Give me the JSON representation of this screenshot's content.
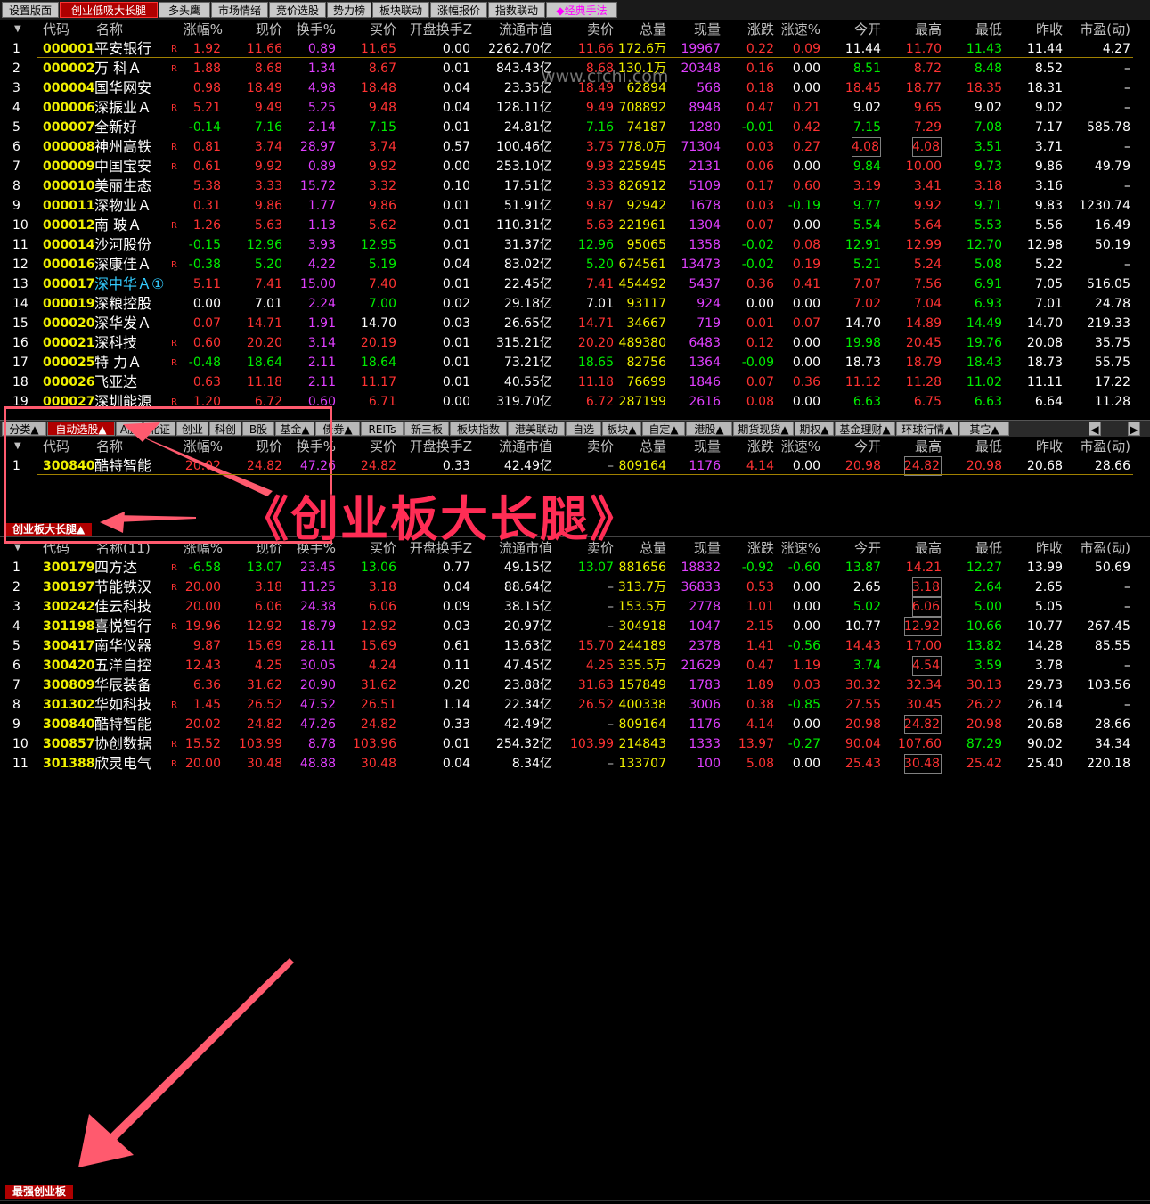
{
  "top_tabs": [
    "设置版面",
    "创业低吸大长腿",
    "多头鹰",
    "市场情绪",
    "竞价选股",
    "势力榜",
    "板块联动",
    "涨幅报价",
    "指数联动",
    "◆经典手法"
  ],
  "columns": [
    "代码",
    "名称",
    "",
    "涨幅%",
    "现价",
    "换手%",
    "买价",
    "开盘换手Z",
    "流通市值",
    "卖价",
    "总量",
    "现量",
    "涨跌",
    "涨速%",
    "今开",
    "最高",
    "最低",
    "昨收",
    "市盈(动)"
  ],
  "columns_lower": [
    "代码",
    "名称(11)",
    "",
    "涨幅%",
    "现价",
    "换手%",
    "买价",
    "开盘换手Z",
    "流通市值",
    "卖价",
    "总量",
    "现量",
    "涨跌",
    "涨速%",
    "今开",
    "最高",
    "最低",
    "昨收",
    "市盈(动)"
  ],
  "watermark": "www.cfchi.com",
  "overlay_title": "《创业板大长腿》",
  "colors": {
    "red": "#ff3333",
    "green": "#00ee00",
    "white": "#ffffff",
    "yellow": "#f0f000",
    "magenta": "#e040ff",
    "cyan": "#33ccff",
    "gray": "#c0c0c0",
    "accent": "#b00000"
  },
  "table1": [
    [
      "1",
      "000001",
      "平安银行",
      "R",
      "1.92",
      "11.66",
      "0.89",
      "11.65",
      "0.00",
      "2262.70亿",
      "11.66",
      "172.6万",
      "19967",
      "0.22",
      "0.09",
      "11.44",
      "11.70",
      "11.43",
      "11.44",
      "4.27"
    ],
    [
      "2",
      "000002",
      "万 科Ａ",
      "R",
      "1.88",
      "8.68",
      "1.34",
      "8.67",
      "0.01",
      "843.43亿",
      "8.68",
      "130.1万",
      "20348",
      "0.16",
      "0.00",
      "8.51",
      "8.72",
      "8.48",
      "8.52",
      "–"
    ],
    [
      "3",
      "000004",
      "国华网安",
      "",
      "0.98",
      "18.49",
      "4.98",
      "18.48",
      "0.04",
      "23.35亿",
      "18.49",
      "62894",
      "568",
      "0.18",
      "0.00",
      "18.45",
      "18.77",
      "18.35",
      "18.31",
      "–"
    ],
    [
      "4",
      "000006",
      "深振业Ａ",
      "R",
      "5.21",
      "9.49",
      "5.25",
      "9.48",
      "0.04",
      "128.11亿",
      "9.49",
      "708892",
      "8948",
      "0.47",
      "0.21",
      "9.02",
      "9.65",
      "9.02",
      "9.02",
      "–"
    ],
    [
      "5",
      "000007",
      "全新好",
      "",
      "-0.14",
      "7.16",
      "2.14",
      "7.15",
      "0.01",
      "24.81亿",
      "7.16",
      "74187",
      "1280",
      "-0.01",
      "0.42",
      "7.15",
      "7.29",
      "7.08",
      "7.17",
      "585.78"
    ],
    [
      "6",
      "000008",
      "神州高铁",
      "R",
      "0.81",
      "3.74",
      "28.97",
      "3.74",
      "0.57",
      "100.46亿",
      "3.75",
      "778.0万",
      "71304",
      "0.03",
      "0.27",
      "4.08",
      "4.08",
      "3.51",
      "3.71",
      "–"
    ],
    [
      "7",
      "000009",
      "中国宝安",
      "R",
      "0.61",
      "9.92",
      "0.89",
      "9.92",
      "0.00",
      "253.10亿",
      "9.93",
      "225945",
      "2131",
      "0.06",
      "0.00",
      "9.84",
      "10.00",
      "9.73",
      "9.86",
      "49.79"
    ],
    [
      "8",
      "000010",
      "美丽生态",
      "",
      "5.38",
      "3.33",
      "15.72",
      "3.32",
      "0.10",
      "17.51亿",
      "3.33",
      "826912",
      "5109",
      "0.17",
      "0.60",
      "3.19",
      "3.41",
      "3.18",
      "3.16",
      "–"
    ],
    [
      "9",
      "000011",
      "深物业Ａ",
      "",
      "0.31",
      "9.86",
      "1.77",
      "9.86",
      "0.01",
      "51.91亿",
      "9.87",
      "92942",
      "1678",
      "0.03",
      "-0.19",
      "9.77",
      "9.92",
      "9.71",
      "9.83",
      "1230.74"
    ],
    [
      "10",
      "000012",
      "南 玻Ａ",
      "R",
      "1.26",
      "5.63",
      "1.13",
      "5.62",
      "0.01",
      "110.31亿",
      "5.63",
      "221961",
      "1304",
      "0.07",
      "0.00",
      "5.54",
      "5.64",
      "5.53",
      "5.56",
      "16.49"
    ],
    [
      "11",
      "000014",
      "沙河股份",
      "",
      "-0.15",
      "12.96",
      "3.93",
      "12.95",
      "0.01",
      "31.37亿",
      "12.96",
      "95065",
      "1358",
      "-0.02",
      "0.08",
      "12.91",
      "12.99",
      "12.70",
      "12.98",
      "50.19"
    ],
    [
      "12",
      "000016",
      "深康佳Ａ",
      "R",
      "-0.38",
      "5.20",
      "4.22",
      "5.19",
      "0.04",
      "83.02亿",
      "5.20",
      "674561",
      "13473",
      "-0.02",
      "0.19",
      "5.21",
      "5.24",
      "5.08",
      "5.22",
      "–"
    ],
    [
      "13",
      "000017",
      "深中华Ａ①",
      "",
      "5.11",
      "7.41",
      "15.00",
      "7.40",
      "0.01",
      "22.45亿",
      "7.41",
      "454492",
      "5437",
      "0.36",
      "0.41",
      "7.07",
      "7.56",
      "6.91",
      "7.05",
      "516.05"
    ],
    [
      "14",
      "000019",
      "深粮控股",
      "",
      "0.00",
      "7.01",
      "2.24",
      "7.00",
      "0.02",
      "29.18亿",
      "7.01",
      "93117",
      "924",
      "0.00",
      "0.00",
      "7.02",
      "7.04",
      "6.93",
      "7.01",
      "24.78"
    ],
    [
      "15",
      "000020",
      "深华发Ａ",
      "",
      "0.07",
      "14.71",
      "1.91",
      "14.70",
      "0.03",
      "26.65亿",
      "14.71",
      "34667",
      "719",
      "0.01",
      "0.07",
      "14.70",
      "14.89",
      "14.49",
      "14.70",
      "219.33"
    ],
    [
      "16",
      "000021",
      "深科技",
      "R",
      "0.60",
      "20.20",
      "3.14",
      "20.19",
      "0.01",
      "315.21亿",
      "20.20",
      "489380",
      "6483",
      "0.12",
      "0.00",
      "19.98",
      "20.45",
      "19.76",
      "20.08",
      "35.75"
    ],
    [
      "17",
      "000025",
      "特 力Ａ",
      "R",
      "-0.48",
      "18.64",
      "2.11",
      "18.64",
      "0.01",
      "73.21亿",
      "18.65",
      "82756",
      "1364",
      "-0.09",
      "0.00",
      "18.73",
      "18.79",
      "18.43",
      "18.73",
      "55.75"
    ],
    [
      "18",
      "000026",
      "飞亚达",
      "",
      "0.63",
      "11.18",
      "2.11",
      "11.17",
      "0.01",
      "40.55亿",
      "11.18",
      "76699",
      "1846",
      "0.07",
      "0.36",
      "11.12",
      "11.28",
      "11.02",
      "11.11",
      "17.22"
    ],
    [
      "19",
      "000027",
      "深圳能源",
      "R",
      "1.20",
      "6.72",
      "0.60",
      "6.71",
      "0.00",
      "319.70亿",
      "6.72",
      "287199",
      "2616",
      "0.08",
      "0.00",
      "6.63",
      "6.75",
      "6.63",
      "6.64",
      "11.28"
    ]
  ],
  "categories": [
    "分类▲",
    "自动选股▲",
    "A股",
    "北证",
    "创业",
    "科创",
    "B股",
    "基金▲",
    "债券▲",
    "REITs",
    "新三板",
    "板块指数",
    "港美联动",
    "自选",
    "板块▲",
    "自定▲",
    "港股▲",
    "期货现货▲",
    "期权▲",
    "基金理财▲",
    "环球行情▲",
    "其它▲"
  ],
  "table2": [
    [
      "1",
      "300840",
      "酷特智能",
      "",
      "20.02",
      "24.82",
      "47.26",
      "24.82",
      "0.33",
      "42.49亿",
      "–",
      "809164",
      "1176",
      "4.14",
      "0.00",
      "20.98",
      "24.82",
      "20.98",
      "20.68",
      "28.66"
    ]
  ],
  "sheet_tab_mid": "创业板大长腿▲",
  "table3": [
    [
      "1",
      "300179",
      "四方达",
      "R",
      "-6.58",
      "13.07",
      "23.45",
      "13.06",
      "0.77",
      "49.15亿",
      "13.07",
      "881656",
      "18832",
      "-0.92",
      "-0.60",
      "13.87",
      "14.21",
      "12.27",
      "13.99",
      "50.69"
    ],
    [
      "2",
      "300197",
      "节能铁汉",
      "R",
      "20.00",
      "3.18",
      "11.25",
      "3.18",
      "0.04",
      "88.64亿",
      "–",
      "313.7万",
      "36833",
      "0.53",
      "0.00",
      "2.65",
      "3.18",
      "2.64",
      "2.65",
      "–"
    ],
    [
      "3",
      "300242",
      "佳云科技",
      "",
      "20.00",
      "6.06",
      "24.38",
      "6.06",
      "0.09",
      "38.15亿",
      "–",
      "153.5万",
      "2778",
      "1.01",
      "0.00",
      "5.02",
      "6.06",
      "5.00",
      "5.05",
      "–"
    ],
    [
      "4",
      "301198",
      "喜悦智行",
      "R",
      "19.96",
      "12.92",
      "18.79",
      "12.92",
      "0.03",
      "20.97亿",
      "–",
      "304918",
      "1047",
      "2.15",
      "0.00",
      "10.77",
      "12.92",
      "10.66",
      "10.77",
      "267.45"
    ],
    [
      "5",
      "300417",
      "南华仪器",
      "",
      "9.87",
      "15.69",
      "28.11",
      "15.69",
      "0.61",
      "13.63亿",
      "15.70",
      "244189",
      "2378",
      "1.41",
      "-0.56",
      "14.43",
      "17.00",
      "13.82",
      "14.28",
      "85.55"
    ],
    [
      "6",
      "300420",
      "五洋自控",
      "",
      "12.43",
      "4.25",
      "30.05",
      "4.24",
      "0.11",
      "47.45亿",
      "4.25",
      "335.5万",
      "21629",
      "0.47",
      "1.19",
      "3.74",
      "4.54",
      "3.59",
      "3.78",
      "–"
    ],
    [
      "7",
      "300809",
      "华辰装备",
      "",
      "6.36",
      "31.62",
      "20.90",
      "31.62",
      "0.20",
      "23.88亿",
      "31.63",
      "157849",
      "1783",
      "1.89",
      "0.03",
      "30.32",
      "32.34",
      "30.13",
      "29.73",
      "103.56"
    ],
    [
      "8",
      "301302",
      "华如科技",
      "R",
      "1.45",
      "26.52",
      "47.52",
      "26.51",
      "1.14",
      "22.34亿",
      "26.52",
      "400338",
      "3006",
      "0.38",
      "-0.85",
      "27.55",
      "30.45",
      "26.22",
      "26.14",
      "–"
    ],
    [
      "9",
      "300840",
      "酷特智能",
      "",
      "20.02",
      "24.82",
      "47.26",
      "24.82",
      "0.33",
      "42.49亿",
      "–",
      "809164",
      "1176",
      "4.14",
      "0.00",
      "20.98",
      "24.82",
      "20.98",
      "20.68",
      "28.66"
    ],
    [
      "10",
      "300857",
      "协创数据",
      "R",
      "15.52",
      "103.99",
      "8.78",
      "103.96",
      "0.01",
      "254.32亿",
      "103.99",
      "214843",
      "1333",
      "13.97",
      "-0.27",
      "90.04",
      "107.60",
      "87.29",
      "90.02",
      "34.34"
    ],
    [
      "11",
      "301388",
      "欣灵电气",
      "R",
      "20.00",
      "30.48",
      "48.88",
      "30.48",
      "0.04",
      "8.34亿",
      "–",
      "133707",
      "100",
      "5.08",
      "0.00",
      "25.43",
      "30.48",
      "25.42",
      "25.40",
      "220.18"
    ]
  ],
  "sheet_tab_bottom": "最强创业板"
}
